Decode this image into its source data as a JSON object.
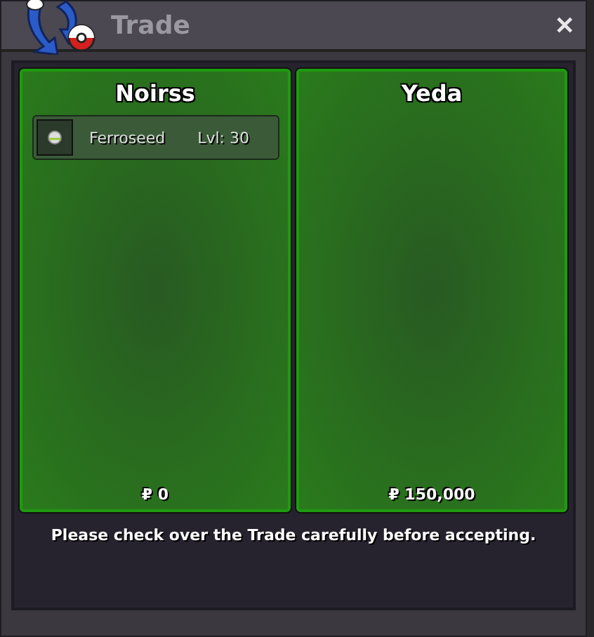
{
  "window": {
    "title": "Trade",
    "close": "✕"
  },
  "parties": [
    {
      "name": "Noirss",
      "items": [
        {
          "name": "Ferroseed",
          "level": "Lvl: 30"
        }
      ],
      "money": "₽ 0"
    },
    {
      "name": "Yeda",
      "money": "₽ 150,000"
    }
  ],
  "message": "Please check over the Trade carefully before accepting."
}
